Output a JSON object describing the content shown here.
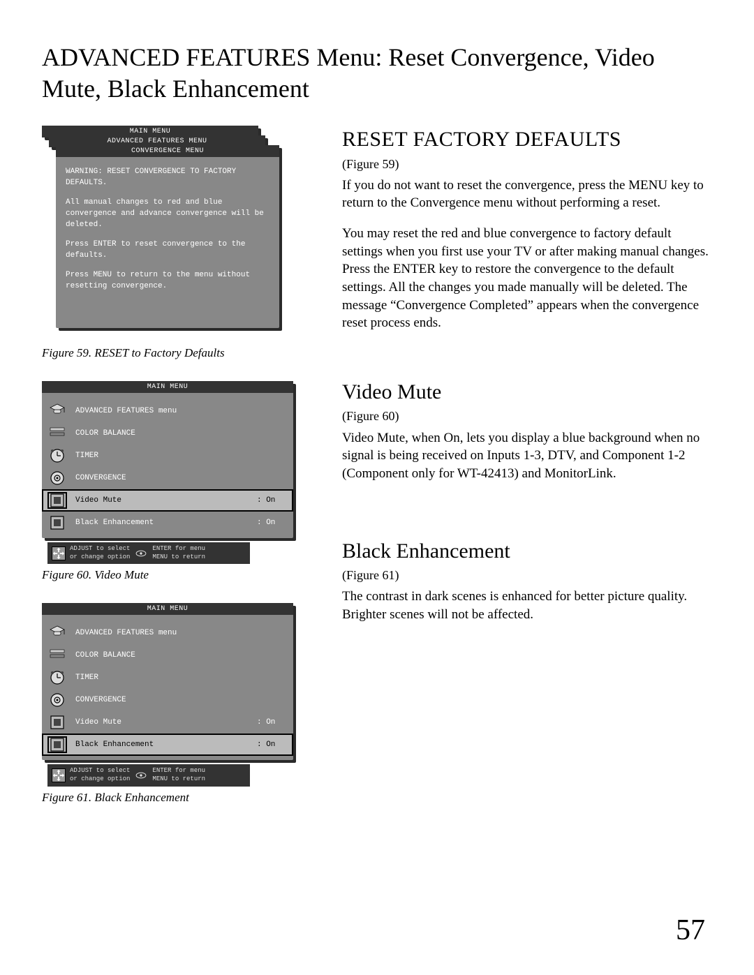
{
  "page": {
    "title": "ADVANCED FEATURES Menu: Reset Convergence, Video Mute, Black Enhancement",
    "number": "57"
  },
  "right": {
    "sec1": {
      "heading": "Reset Factory Defaults",
      "figref": "(Figure 59)",
      "p1": "If you do not want to reset the convergence, press the MENU key to return to the Convergence menu without performing a reset.",
      "p2": "You may reset the red and blue convergence to factory default settings when you first use your TV or after making manual changes. Press the ENTER key to restore the convergence to the default settings. All the changes you made manually will be deleted. The message  “Convergence Completed” appears when the convergence reset process ends."
    },
    "sec2": {
      "heading": "Video Mute",
      "figref": "(Figure 60)",
      "p1": "Video Mute, when On, lets you display a blue background when no signal is being received on Inputs 1-3, DTV, and Component 1-2 (Component only for WT-42413)  and MonitorLink."
    },
    "sec3": {
      "heading": "Black Enhancement",
      "figref": "(Figure 61)",
      "p1": "The contrast in dark scenes is enhanced for better picture quality.  Brighter scenes will not be affected."
    }
  },
  "fig59": {
    "caption": "Figure 59.  RESET to Factory Defaults",
    "layer0_title": "MAIN MENU",
    "layer1_title": "ADVANCED FEATURES MENU",
    "layer2_title": "CONVERGENCE MENU",
    "body_p1": "WARNING:  RESET CONVERGENCE TO FACTORY DEFAULTS.",
    "body_p2": "All manual changes to red and blue convergence and advance convergence will be deleted.",
    "body_p3": "Press ENTER to reset convergence to the defaults.",
    "body_p4": "Press MENU to return to the menu without resetting convergence."
  },
  "advmenu": {
    "title": "MAIN MENU",
    "rows": [
      {
        "icon": "gradcap",
        "label": "ADVANCED FEATURES menu",
        "val": ""
      },
      {
        "icon": "bars",
        "label": "COLOR BALANCE",
        "val": ""
      },
      {
        "icon": "clock",
        "label": "TIMER",
        "val": ""
      },
      {
        "icon": "converge",
        "label": "CONVERGENCE",
        "val": ""
      },
      {
        "icon": "square",
        "label": "Video Mute",
        "val": ": On"
      },
      {
        "icon": "square",
        "label": "Black Enhancement",
        "val": ": On"
      }
    ],
    "hint_line1a": "ADJUST to select",
    "hint_line1b": "ENTER for menu",
    "hint_line2a": "or change option",
    "hint_line2b": "MENU  to return"
  },
  "fig60": {
    "caption": "Figure 60.  Video Mute",
    "selected_index": 4
  },
  "fig61": {
    "caption": "Figure 61.  Black Enhancement",
    "selected_index": 5
  }
}
